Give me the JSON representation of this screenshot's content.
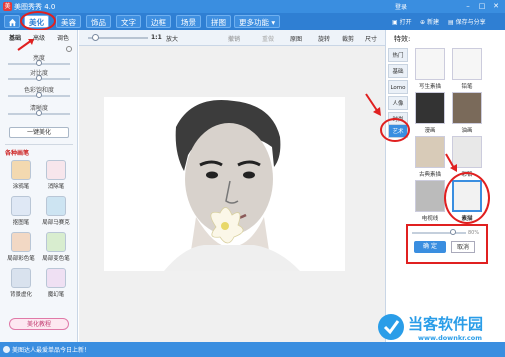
{
  "app": {
    "logo_glyph": "美",
    "title": "美图秀秀 4.0",
    "login": "登录",
    "minimize": "–",
    "maximize": "□",
    "close": "✕"
  },
  "nav": {
    "home_icon": "home-icon",
    "tabs": [
      "美化",
      "美容",
      "饰品",
      "文字",
      "边框",
      "场景",
      "拼图",
      "更多功能 ▾"
    ],
    "active_tab": "美化",
    "open": "打开",
    "new": "新建",
    "save_share": "保存与分享"
  },
  "left": {
    "tabs": [
      "基础",
      "高级",
      "调色"
    ],
    "sliders": [
      {
        "label": "亮度",
        "value": 0.5
      },
      {
        "label": "对比度",
        "value": 0.5
      },
      {
        "label": "色彩饱和度",
        "value": 0.5
      },
      {
        "label": "清晰度",
        "value": 0.5
      }
    ],
    "one_click": "一键美化",
    "brush_title": "各种画笔",
    "tools": [
      "涂鸦笔",
      "消除笔",
      "抠图笔",
      "局部马赛克",
      "局部彩色笔",
      "局部变色笔",
      "背景虚化",
      "魔幻笔"
    ],
    "tutorial": "美化教程"
  },
  "toolbar": {
    "zoom_ratio": "1:1",
    "zoom_in": "放大",
    "rotate": "旋转",
    "crop": "裁剪",
    "resize": "尺寸",
    "undo": "撤销",
    "redo": "重做",
    "original": "原图"
  },
  "right": {
    "title": "特效:",
    "categories": [
      "热门",
      "基础",
      "Lomo",
      "人像",
      "时尚",
      "艺术"
    ],
    "active_category": "艺术",
    "effects": [
      "写生素描",
      "铅笔",
      "漫画",
      "油画",
      "古典素描",
      "彩铅",
      "电视线",
      "素描"
    ],
    "selected_effect": "素描",
    "opacity": "80%",
    "ok": "确 定",
    "cancel": "取消"
  },
  "status": {
    "text": "美图达人最爱单品今日上新！"
  },
  "watermark": {
    "text": "当客软件园",
    "url": "www.downkr.com"
  },
  "colors": {
    "brand": "#3a8ee0",
    "highlight": "#e02020"
  }
}
